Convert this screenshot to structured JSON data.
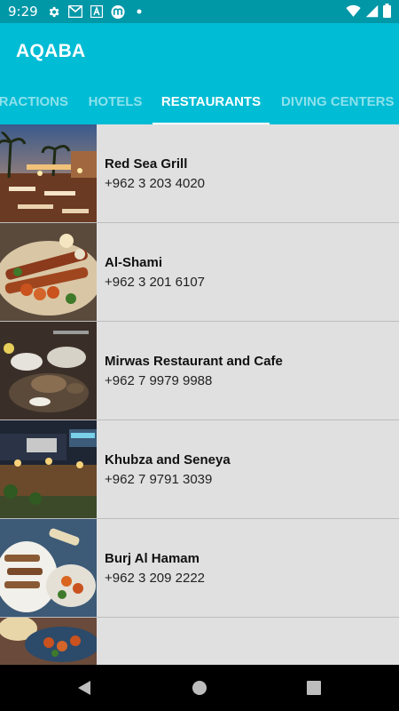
{
  "status_bar": {
    "time": "9:29",
    "left_icons": [
      "settings-icon",
      "gmail-icon",
      "drive-icon",
      "app-m-icon",
      "dot-icon"
    ],
    "right_icons": [
      "wifi-icon",
      "signal-icon",
      "battery-icon"
    ]
  },
  "app_bar": {
    "title": "AQABA"
  },
  "tabs": [
    {
      "label": "ATTRACTIONS",
      "visible_label": "RACTIONS",
      "active": false
    },
    {
      "label": "HOTELS",
      "visible_label": "HOTELS",
      "active": false
    },
    {
      "label": "RESTAURANTS",
      "visible_label": "RESTAURANTS",
      "active": true
    },
    {
      "label": "DIVING CENTERS",
      "visible_label": "DIVING CENTERS",
      "active": false
    }
  ],
  "restaurants": [
    {
      "name": "Red Sea Grill",
      "phone": "+962 3 203 4020"
    },
    {
      "name": "Al-Shami",
      "phone": "+962 3 201 6107"
    },
    {
      "name": "Mirwas Restaurant and Cafe",
      "phone": "+962 7 9979 9988"
    },
    {
      "name": "Khubza and Seneya",
      "phone": "+962 7 9791 3039"
    },
    {
      "name": "Burj Al Hamam",
      "phone": "+962 3 209 2222"
    },
    {
      "name": "",
      "phone": ""
    }
  ],
  "nav_bar": {
    "buttons": [
      "back-button",
      "home-button",
      "recents-button"
    ]
  },
  "colors": {
    "status_bar": "#0097a7",
    "app_bar": "#00bcd4",
    "list_background": "#e0e0e0",
    "nav_bar": "#000000"
  }
}
